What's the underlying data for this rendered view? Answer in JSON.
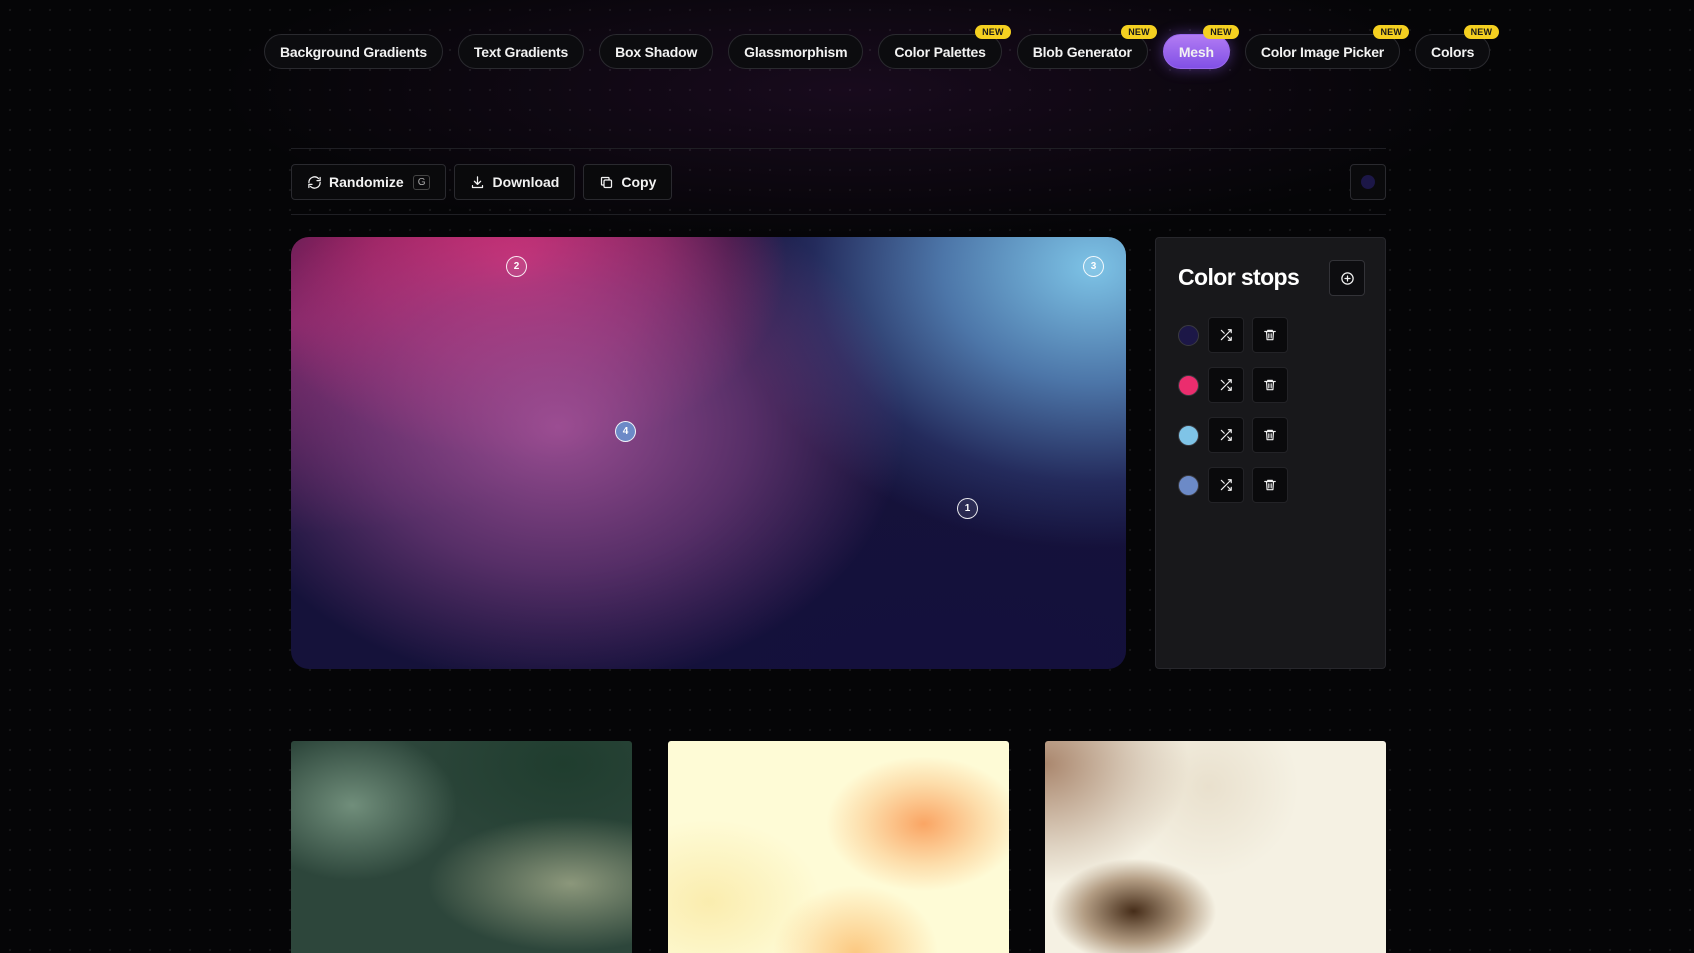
{
  "nav": {
    "items": [
      {
        "label": "Background Gradients",
        "badge": ""
      },
      {
        "label": "Text Gradients",
        "badge": ""
      },
      {
        "label": "Box Shadow",
        "badge": ""
      },
      {
        "label": "Glassmorphism",
        "badge": ""
      },
      {
        "label": "Color Palettes",
        "badge": "NEW"
      },
      {
        "label": "Blob Generator",
        "badge": "NEW"
      },
      {
        "label": "Mesh",
        "badge": "NEW"
      },
      {
        "label": "Color Image Picker",
        "badge": "NEW"
      },
      {
        "label": "Colors",
        "badge": "NEW"
      }
    ],
    "active_item": "Mesh"
  },
  "toolbar": {
    "randomize_label": "Randomize",
    "randomize_shortcut": "G",
    "download_label": "Download",
    "copy_label": "Copy",
    "background_color": "#1c1747"
  },
  "mesh": {
    "handles": [
      {
        "label": "2"
      },
      {
        "label": "3"
      },
      {
        "label": "4"
      },
      {
        "label": "1"
      }
    ]
  },
  "color_stops": {
    "title": "Color stops",
    "stops": [
      {
        "color": "#1c1747"
      },
      {
        "color": "#eb2d6e"
      },
      {
        "color": "#7fc4e7"
      },
      {
        "color": "#6c8ac7"
      }
    ]
  },
  "presets": [
    {
      "name": "green-mesh",
      "base": "#2d463b"
    },
    {
      "name": "cream-peach-mesh",
      "base": "#fefbd6"
    },
    {
      "name": "beige-brown-mesh",
      "base": "#f5f1e3"
    }
  ]
}
